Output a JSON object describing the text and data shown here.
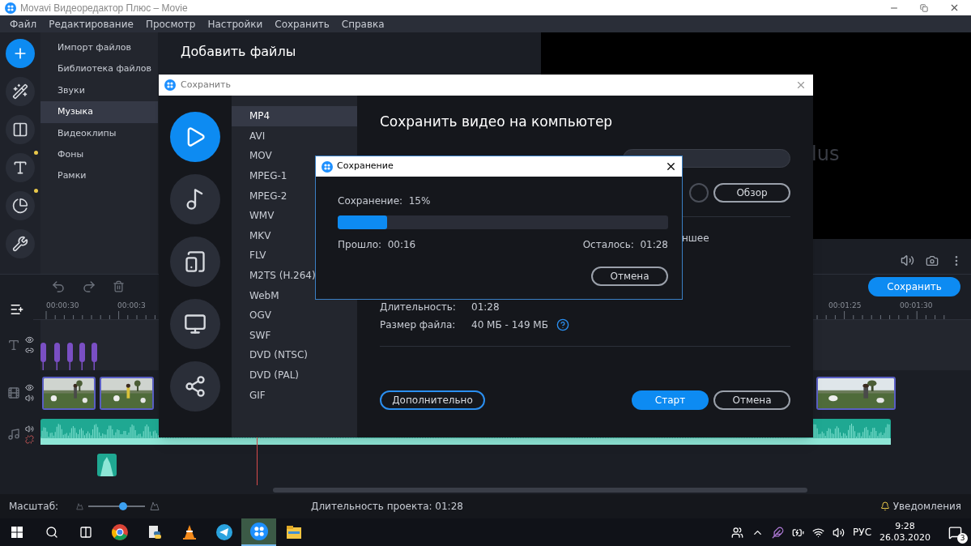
{
  "window": {
    "title": "Movavi Видеоредактор Плюс – Movie"
  },
  "menu": [
    {
      "label": "Файл"
    },
    {
      "label": "Редактирование"
    },
    {
      "label": "Просмотр"
    },
    {
      "label": "Настройки"
    },
    {
      "label": "Сохранить"
    },
    {
      "label": "Справка"
    }
  ],
  "tools": [
    {
      "kind": "add",
      "selected": true,
      "badge": false
    },
    {
      "kind": "filters",
      "selected": false,
      "badge": false
    },
    {
      "kind": "transitions",
      "selected": false,
      "badge": false
    },
    {
      "kind": "titles",
      "selected": false,
      "badge": true
    },
    {
      "kind": "stickers",
      "selected": false,
      "badge": true
    },
    {
      "kind": "tools",
      "selected": false,
      "badge": false
    }
  ],
  "categories": [
    {
      "label": "Импорт файлов",
      "selected": false
    },
    {
      "label": "Библиотека файлов",
      "selected": false
    },
    {
      "label": "Звуки",
      "selected": false
    },
    {
      "label": "Музыка",
      "selected": true
    },
    {
      "label": "Видеоклипы",
      "selected": false
    },
    {
      "label": "Фоны",
      "selected": false
    },
    {
      "label": "Рамки",
      "selected": false
    }
  ],
  "panel_title": "Добавить файлы",
  "preview": {
    "overlay_text": "lus"
  },
  "timeline": {
    "save_button": "Сохранить",
    "ticks_left": [
      "00:00:30",
      "00:00:3"
    ],
    "ticks_right": [
      "00:01:25",
      "00:01:30"
    ]
  },
  "status_bar": {
    "zoom_label": "Масштаб:",
    "zoom": {
      "level": 0.62
    },
    "duration": "Длительность проекта: 01:28",
    "notifications": "Уведомления"
  },
  "taskbar": {
    "apps": [
      {
        "kind": "browser",
        "selected": false
      },
      {
        "kind": "python",
        "selected": false
      },
      {
        "kind": "cone",
        "selected": false
      },
      {
        "kind": "plane",
        "selected": false
      },
      {
        "kind": "movavi",
        "selected": true
      },
      {
        "kind": "folder",
        "selected": false
      }
    ],
    "language": "РУС",
    "time": "9:28",
    "date": "26.03.2020",
    "notification_count": "3"
  },
  "save_dialog": {
    "title": "Сохранить",
    "targets": [
      {
        "kind": "video",
        "selected": true
      },
      {
        "kind": "audio",
        "selected": false
      },
      {
        "kind": "devices",
        "selected": false
      },
      {
        "kind": "tv",
        "selected": false
      },
      {
        "kind": "share",
        "selected": false
      }
    ],
    "formats": [
      {
        "label": "MP4",
        "selected": true
      },
      {
        "label": "AVI",
        "selected": false
      },
      {
        "label": "MOV",
        "selected": false
      },
      {
        "label": "MPEG-1",
        "selected": false
      },
      {
        "label": "MPEG-2",
        "selected": false
      },
      {
        "label": "WMV",
        "selected": false
      },
      {
        "label": "MKV",
        "selected": false
      },
      {
        "label": "FLV",
        "selected": false
      },
      {
        "label": "M2TS (H.264)",
        "selected": false
      },
      {
        "label": "WebM",
        "selected": false
      },
      {
        "label": "OGV",
        "selected": false
      },
      {
        "label": "SWF",
        "selected": false
      },
      {
        "label": "DVD (NTSC)",
        "selected": false
      },
      {
        "label": "DVD (PAL)",
        "selected": false
      },
      {
        "label": "GIF",
        "selected": false
      }
    ],
    "heading": "Сохранить видео на компьютер",
    "browse_button": "Обзор",
    "quality_fragment": "ншее",
    "duration_label": "Длительность:",
    "duration_value": "01:28",
    "size_label": "Размер файла:",
    "size_value": "40 МБ - 149 МБ",
    "advanced_button": "Дополнительно",
    "start_button": "Старт",
    "cancel_button": "Отмена"
  },
  "progress_dialog": {
    "title": "Сохранение",
    "status": "Сохранение:  15%",
    "progress": {
      "level": 0.15
    },
    "elapsed": "Прошло:  00:16",
    "remaining": "Осталось:  01:28",
    "cancel_button": "Отмена"
  }
}
